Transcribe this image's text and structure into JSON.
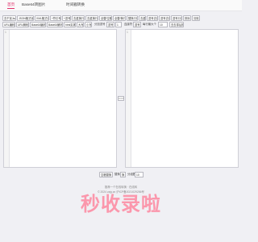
{
  "nav": {
    "tabs": [
      {
        "label": "首页",
        "active": true
      },
      {
        "label": "Base64转图片"
      },
      {
        "label": "时间戳转换"
      }
    ]
  },
  "toolbar": {
    "row1": [
      "去干扰Json",
      "JSON格式化",
      "XML格式化",
      "+符引号",
      "+逗号",
      "去重换行",
      "去重换行",
      "全替/空格",
      "全替/换行",
      "替换行行",
      "去重",
      "逗号去开",
      "逗号去开",
      "逗号分割",
      "排序",
      "清除"
    ],
    "row2": [
      "URL编码",
      "URL解码",
      "Base64编码",
      "Base64解码",
      "html实体",
      "大写",
      "小写"
    ],
    "split_label": "分割逗号",
    "split_value": "逗号",
    "split_num": "1",
    "join_label": "连接符",
    "join_value": "逗号",
    "count_label": "每行最大个",
    "count_value": "10",
    "go_label": "去去零后换"
  },
  "editors": {
    "left": {
      "line": "1"
    },
    "right": {
      "line": "1"
    },
    "swap": "==>"
  },
  "bottom": {
    "btn": "空格替换",
    "sep_label": "替换",
    "sep_value": "换",
    "count_label": "分组数",
    "count_value": "10"
  },
  "footer": {
    "line1": "推荐一个在线转换 · 在线转",
    "line2": "© 2024 zajy.cn 沪ICP备2021029256号"
  },
  "brand": "秒收录啦"
}
